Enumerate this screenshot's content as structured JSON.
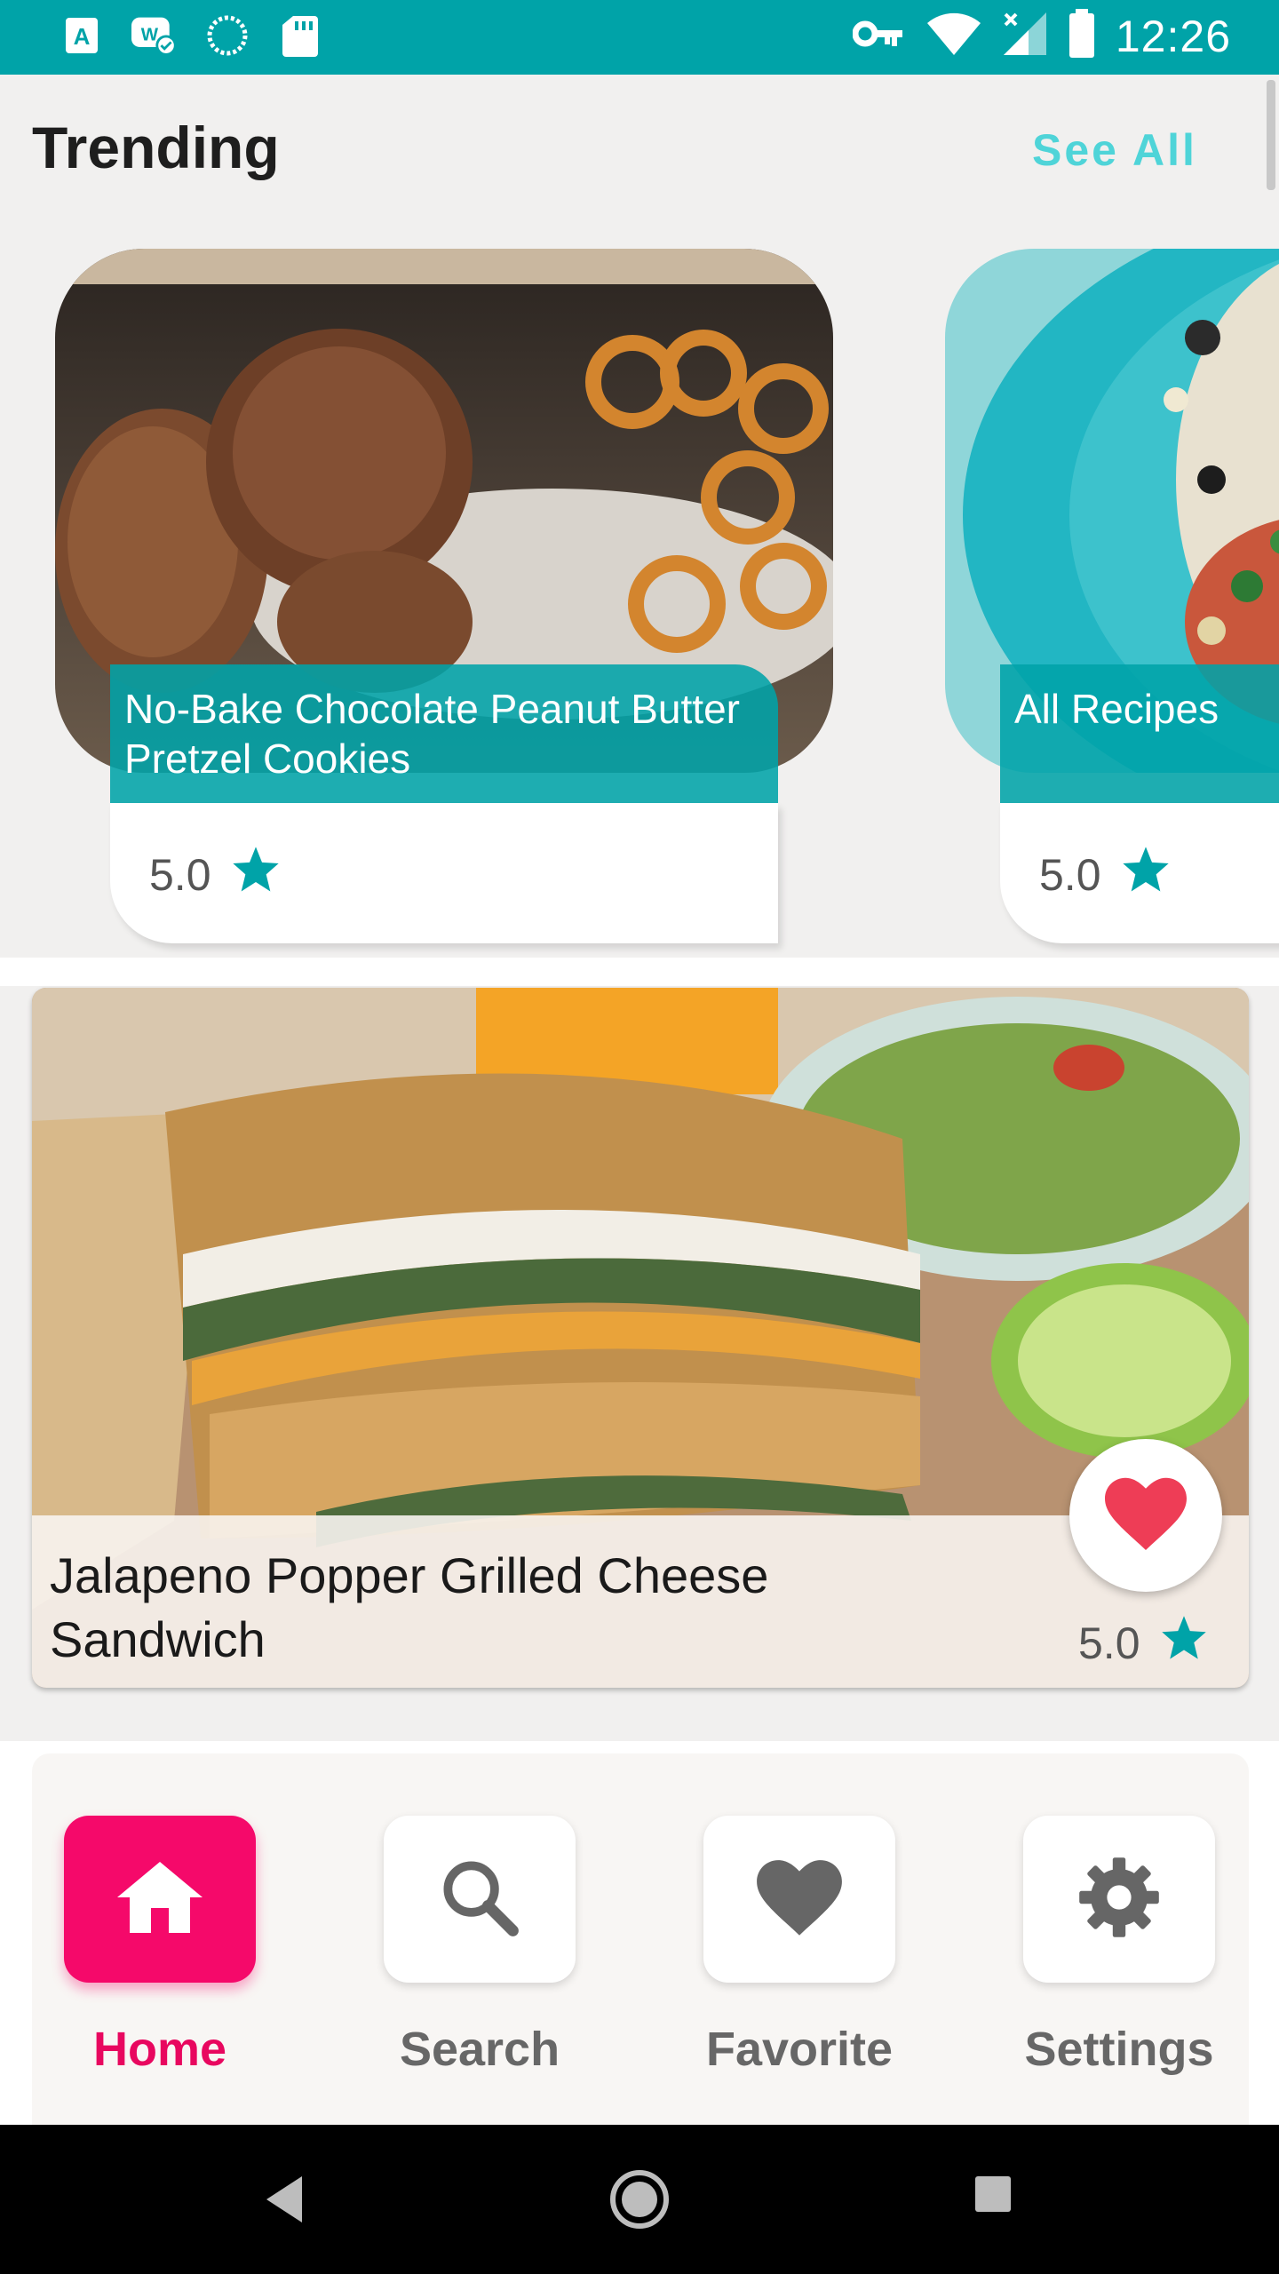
{
  "status_bar": {
    "time": "12:26",
    "left_icons": [
      "accessibility-icon",
      "badge-check-icon",
      "sync-circle-icon",
      "sd-card-icon"
    ],
    "right_icons": [
      "vpn-key-icon",
      "wifi-icon",
      "cell-signal-icon",
      "battery-icon"
    ]
  },
  "trending": {
    "title": "Trending",
    "see_all": "See All",
    "cards": [
      {
        "title": "No-Bake Chocolate Peanut Butter Pretzel Cookies",
        "rating": "5.0"
      },
      {
        "title": "All Recipes",
        "rating": "5.0"
      }
    ]
  },
  "feature": {
    "title": "Jalapeno Popper Grilled Cheese Sandwich",
    "rating": "5.0",
    "favorited": true
  },
  "bottom_nav": {
    "items": [
      {
        "label": "Home",
        "icon": "home-icon",
        "active": true
      },
      {
        "label": "Search",
        "icon": "search-icon",
        "active": false
      },
      {
        "label": "Favorite",
        "icon": "heart-icon",
        "active": false
      },
      {
        "label": "Settings",
        "icon": "gear-icon",
        "active": false
      }
    ]
  },
  "colors": {
    "accent": "#00a3a8",
    "star": "#00a3a8",
    "see_all": "#4fd4d8",
    "nav_active": "#f5096a",
    "heart": "#ee3d56"
  }
}
